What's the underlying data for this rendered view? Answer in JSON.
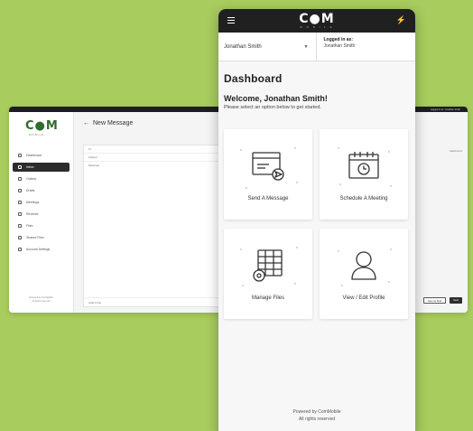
{
  "desktop": {
    "logo": "C●M",
    "logo_sub": "MOBILE",
    "nav": [
      {
        "label": "Dashboard",
        "icon": "grid-icon",
        "active": false
      },
      {
        "label": "Inbox",
        "icon": "inbox-icon",
        "active": true
      },
      {
        "label": "Outbox",
        "icon": "outbox-icon",
        "active": false
      },
      {
        "label": "Drafts",
        "icon": "drafts-icon",
        "active": false
      },
      {
        "label": "Meetings",
        "icon": "calendar-icon",
        "active": false
      },
      {
        "label": "Reviews",
        "icon": "reviews-icon",
        "active": false
      },
      {
        "label": "Files",
        "icon": "files-icon",
        "active": false
      },
      {
        "label": "Shared Files",
        "icon": "shared-files-icon",
        "active": false
      },
      {
        "label": "Account Settings",
        "icon": "gear-icon",
        "active": false
      }
    ],
    "footer_line1": "Powered by ComMobile",
    "footer_line2": "All rights reserved",
    "header_back": "←",
    "header_title": "New Message",
    "field_to": "To",
    "field_subject": "Subject",
    "field_message": "Message",
    "attach_label": "Attach File",
    "top_right": "Logged in as: Jonathan Smith",
    "mid_right": "Attachments",
    "btn_save": "Save as Draft",
    "btn_send": "Send"
  },
  "phone": {
    "logo": "C●M",
    "logo_sub": "M O B I L E",
    "logout_icon": "⚡",
    "account_select": "Jonathan Smith",
    "logged_in_label": "Logged in as:",
    "logged_in_user": "Jonathan Smith",
    "title": "Dashboard",
    "welcome": "Welcome, Jonathan Smith!",
    "description": "Please select an option below to get started.",
    "tiles": [
      {
        "label": "Send A Message",
        "icon": "send-message-icon"
      },
      {
        "label": "Schedule A Meeting",
        "icon": "schedule-meeting-icon"
      },
      {
        "label": "Manage Files",
        "icon": "manage-files-icon"
      },
      {
        "label": "View / Edit Profile",
        "icon": "profile-icon"
      }
    ],
    "footer_line1": "Powered by ComMobile",
    "footer_line2": "All rights reserved"
  },
  "colors": {
    "background": "#a8cc5e",
    "dark_bar": "#202020",
    "brand_green": "#2f6b2a"
  }
}
